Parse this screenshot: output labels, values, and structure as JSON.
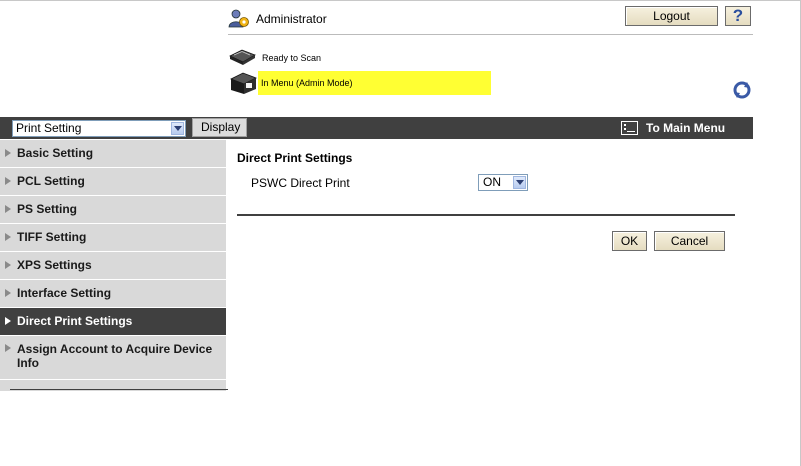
{
  "header": {
    "user_label": "Administrator",
    "logout_label": "Logout",
    "help_label": "?"
  },
  "status": {
    "ready": "Ready to Scan",
    "mode": "In Menu (Admin Mode)",
    "mode_highlight": "#ffff33"
  },
  "toolbar": {
    "category_value": "Print Setting",
    "display_label": "Display",
    "main_menu_label": "To Main Menu",
    "bar_color": "#404040"
  },
  "sidebar": {
    "items": [
      {
        "label": "Basic Setting"
      },
      {
        "label": "PCL Setting"
      },
      {
        "label": "PS Setting"
      },
      {
        "label": "TIFF Setting"
      },
      {
        "label": "XPS Settings"
      },
      {
        "label": "Interface Setting"
      },
      {
        "label": "Direct Print Settings"
      },
      {
        "label": "Assign Account to Acquire Device Info"
      }
    ],
    "active_index": 6
  },
  "main": {
    "title": "Direct Print Settings",
    "field_label": "PSWC Direct Print",
    "field_value": "ON",
    "ok_label": "OK",
    "cancel_label": "Cancel"
  }
}
